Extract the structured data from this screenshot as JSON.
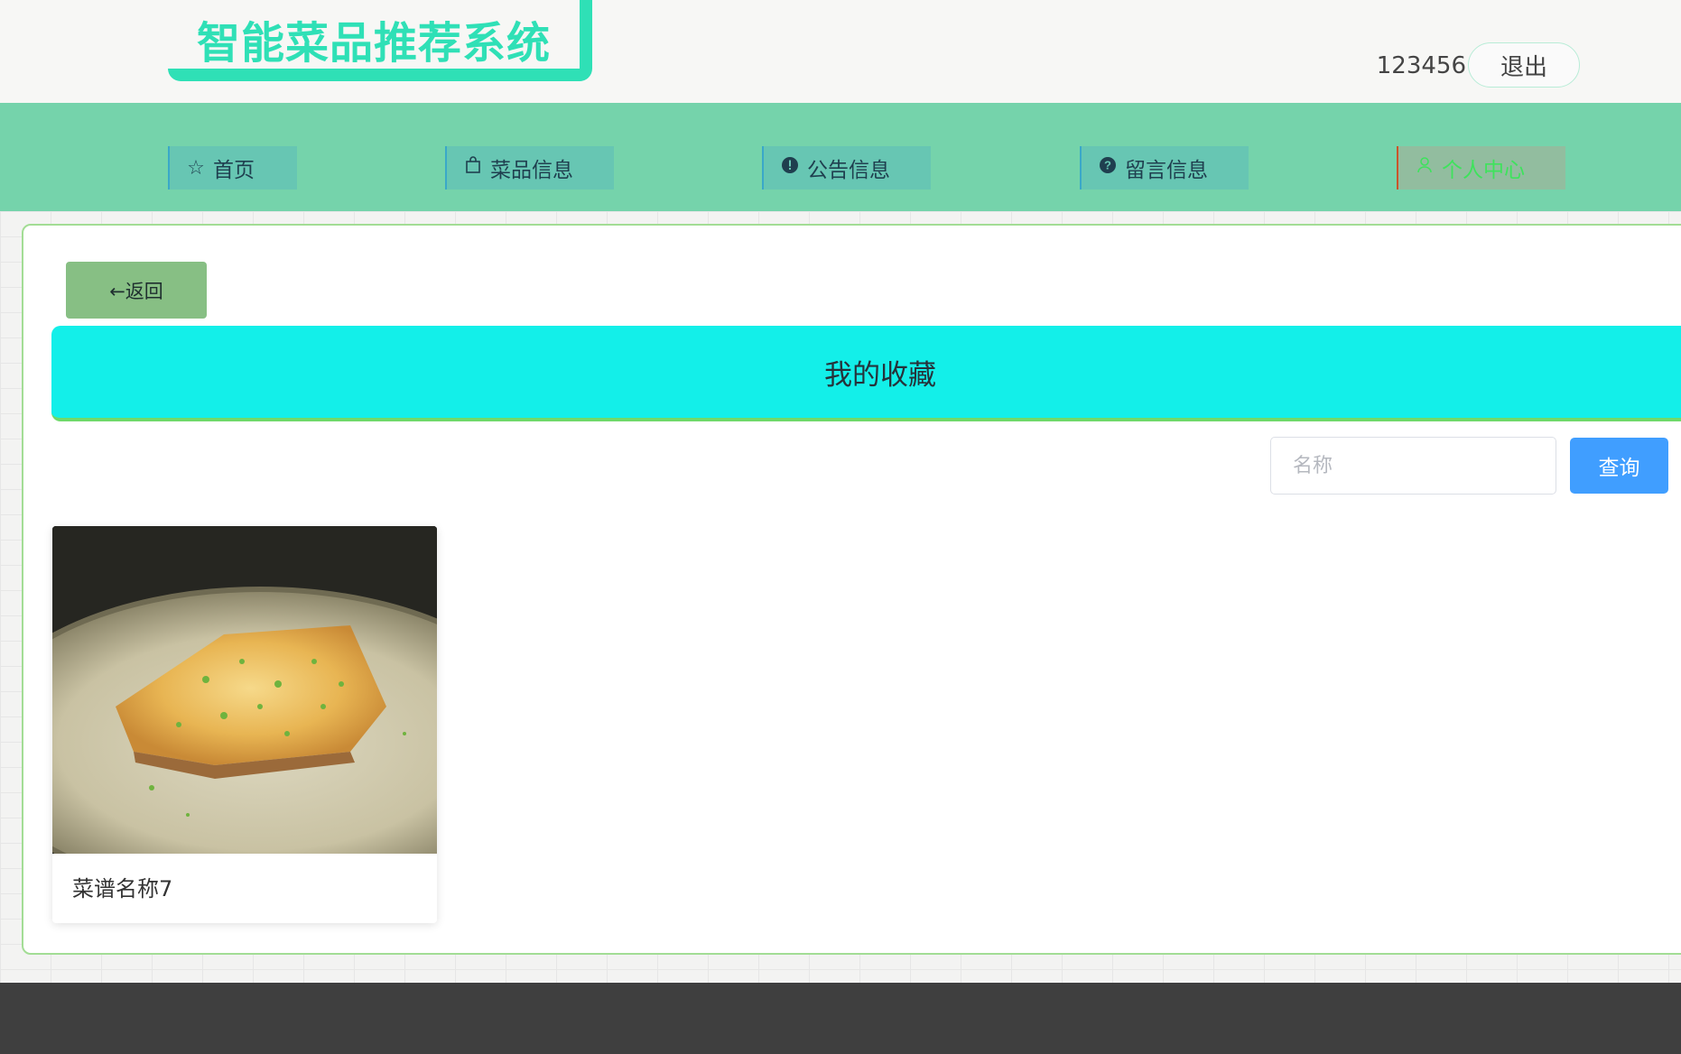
{
  "header": {
    "logo_text": "智能菜品推荐系统",
    "username": "123456",
    "logout_label": "退出"
  },
  "nav": {
    "items": [
      {
        "label": "首页",
        "icon": "star-icon"
      },
      {
        "label": "菜品信息",
        "icon": "shopping-bag-icon"
      },
      {
        "label": "公告信息",
        "icon": "info-circle-icon"
      },
      {
        "label": "留言信息",
        "icon": "question-circle-icon"
      },
      {
        "label": "个人中心",
        "icon": "user-icon",
        "active": true
      }
    ]
  },
  "page": {
    "back_label": "←返回",
    "title": "我的收藏"
  },
  "search": {
    "placeholder": "名称",
    "button_label": "查询"
  },
  "favorites": [
    {
      "name": "菜谱名称7",
      "image": "dish-photo"
    }
  ],
  "colors": {
    "accent": "#2fe0b6",
    "nav_bg": "#75d3ab",
    "banner_bg": "#13efe9",
    "search_button": "#409eff",
    "back_button": "#87bf84",
    "footer": "#3f3f3f"
  }
}
